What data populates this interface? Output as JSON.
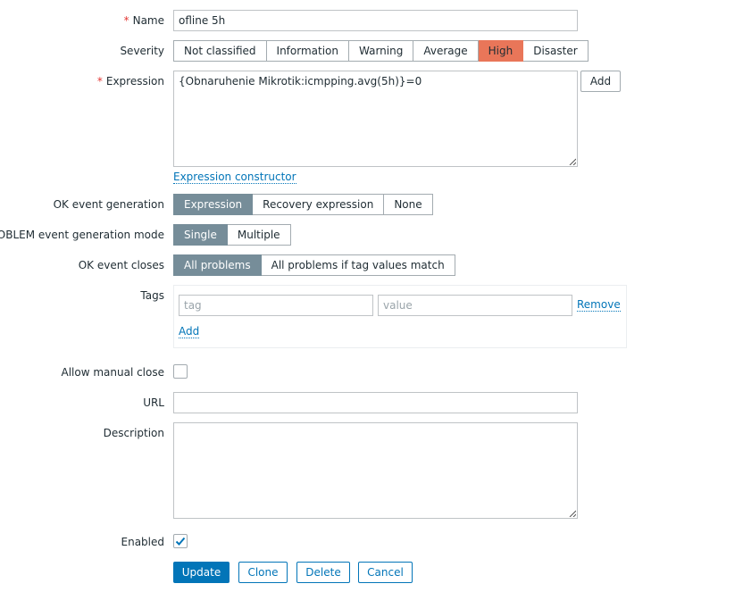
{
  "fields": {
    "name": {
      "label": "Name",
      "required_mark": "*",
      "value": "ofline 5h"
    },
    "severity": {
      "label": "Severity",
      "options": [
        "Not classified",
        "Information",
        "Warning",
        "Average",
        "High",
        "Disaster"
      ],
      "selected": "High"
    },
    "expression": {
      "label": "Expression",
      "required_mark": "*",
      "value": "{Obnaruhenie Mikrotik:icmpping.avg(5h)}=0",
      "add_label": "Add",
      "constructor_link": "Expression constructor"
    },
    "ok_event_generation": {
      "label": "OK event generation",
      "options": [
        "Expression",
        "Recovery expression",
        "None"
      ],
      "selected": "Expression"
    },
    "problem_mode": {
      "label": "PROBLEM event generation mode",
      "options": [
        "Single",
        "Multiple"
      ],
      "selected": "Single"
    },
    "ok_event_closes": {
      "label": "OK event closes",
      "options": [
        "All problems",
        "All problems if tag values match"
      ],
      "selected": "All problems"
    },
    "tags": {
      "label": "Tags",
      "tag_placeholder": "tag",
      "value_placeholder": "value",
      "remove_label": "Remove",
      "add_label": "Add"
    },
    "allow_manual_close": {
      "label": "Allow manual close",
      "checked": false
    },
    "url": {
      "label": "URL",
      "value": ""
    },
    "description": {
      "label": "Description",
      "value": ""
    },
    "enabled": {
      "label": "Enabled",
      "checked": true
    }
  },
  "actions": {
    "update": "Update",
    "clone": "Clone",
    "delete": "Delete",
    "cancel": "Cancel"
  },
  "colors": {
    "accent": "#0275b8",
    "selected_segment": "#768d99",
    "severity_high": "#e97659",
    "required": "#e33734"
  }
}
